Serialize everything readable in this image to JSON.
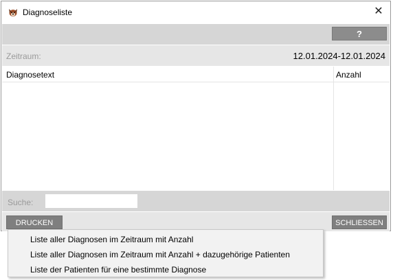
{
  "window": {
    "title": "Diagnoseliste",
    "app_icon": "dog-head-icon",
    "close_glyph": "✕"
  },
  "toolbar": {
    "help_label": "?"
  },
  "range": {
    "label": "Zeitraum:",
    "value": "12.01.2024-12.01.2024"
  },
  "table": {
    "columns": [
      "Diagnosetext",
      "Anzahl"
    ],
    "rows": []
  },
  "search": {
    "label": "Suche:",
    "value": "",
    "placeholder": ""
  },
  "buttons": {
    "print": "DRUCKEN",
    "close": "SCHLIESSEN"
  },
  "print_menu": {
    "items": [
      "Liste aller Diagnosen im Zeitraum mit Anzahl",
      "Liste aller Diagnosen im Zeitraum mit Anzahl + dazugehörige Patienten",
      "Liste der Patienten für eine bestimmte Diagnose"
    ]
  },
  "colors": {
    "toolbar_bg": "#d6d6d6",
    "row_bg": "#e6e6e6",
    "button_bg": "#7f7f7f",
    "menu_bg": "#f2f2f2"
  }
}
